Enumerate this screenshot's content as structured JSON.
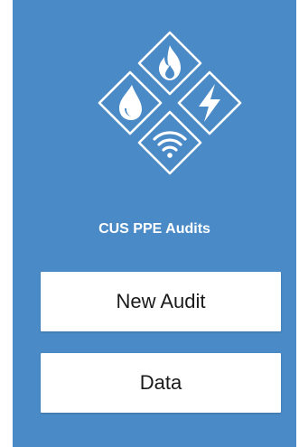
{
  "app": {
    "title": "CUS PPE Audits",
    "background_color": "#4a8ac6",
    "logo_icons": [
      "fire-icon",
      "water-drop-icon",
      "lightning-icon",
      "wifi-icon"
    ]
  },
  "menu": {
    "new_audit_label": "New Audit",
    "data_label": "Data"
  }
}
